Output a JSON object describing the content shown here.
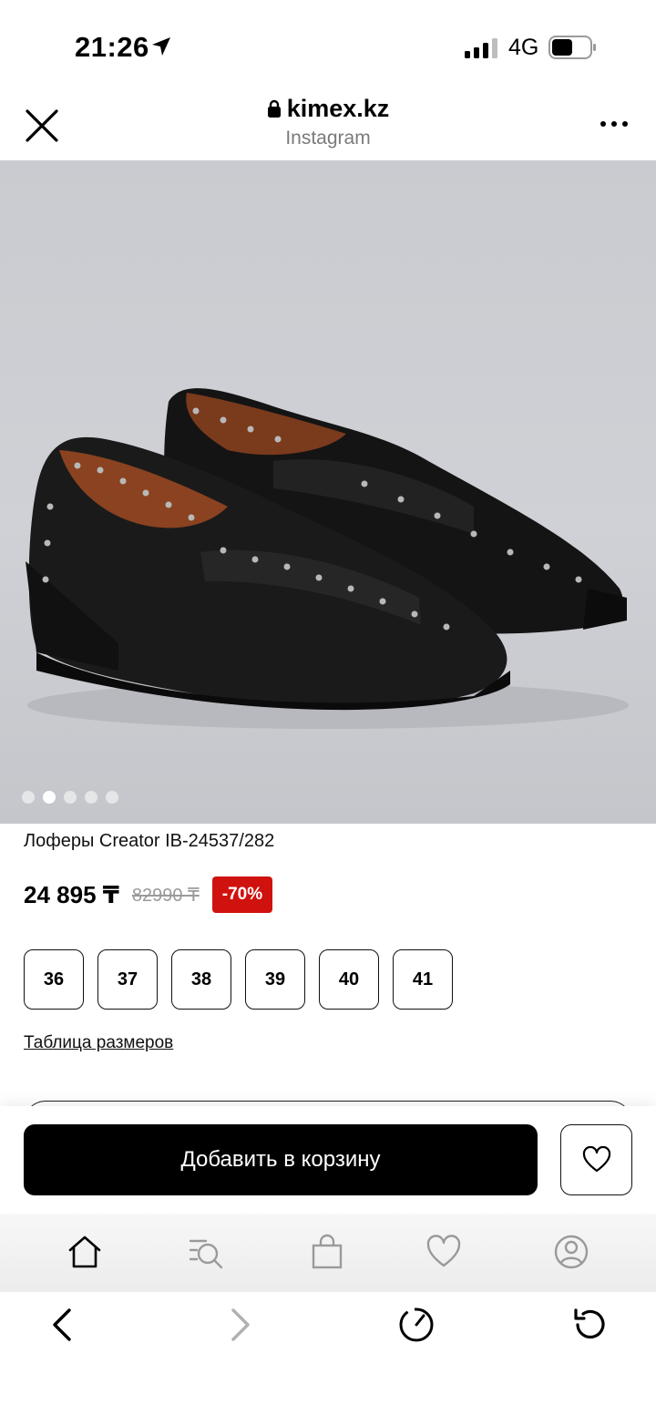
{
  "status_bar": {
    "time": "21:26",
    "network": "4G"
  },
  "browser": {
    "domain": "kimex.kz",
    "source": "Instagram"
  },
  "gallery": {
    "total_images": 5,
    "active_index": 1
  },
  "product": {
    "title": "Лоферы Creator IB-24537/282",
    "price": "24 895 ₸",
    "old_price": "82990 ₸",
    "discount": "-70%",
    "sizes": [
      "36",
      "37",
      "38",
      "39",
      "40",
      "41"
    ],
    "size_table_label": "Таблица размеров"
  },
  "actions": {
    "add_to_cart_label": "Добавить в корзину"
  },
  "site_nav": {
    "icons": [
      "home-icon",
      "catalog-search-icon",
      "bag-icon",
      "heart-icon",
      "profile-icon"
    ],
    "active": "home-icon"
  },
  "browser_toolbar": {
    "icons": [
      "back-icon",
      "forward-icon",
      "speed-icon",
      "reload-icon"
    ]
  },
  "colors": {
    "accent": "#000000",
    "discount_bg": "#d0120f",
    "muted": "#9a9a9a"
  }
}
